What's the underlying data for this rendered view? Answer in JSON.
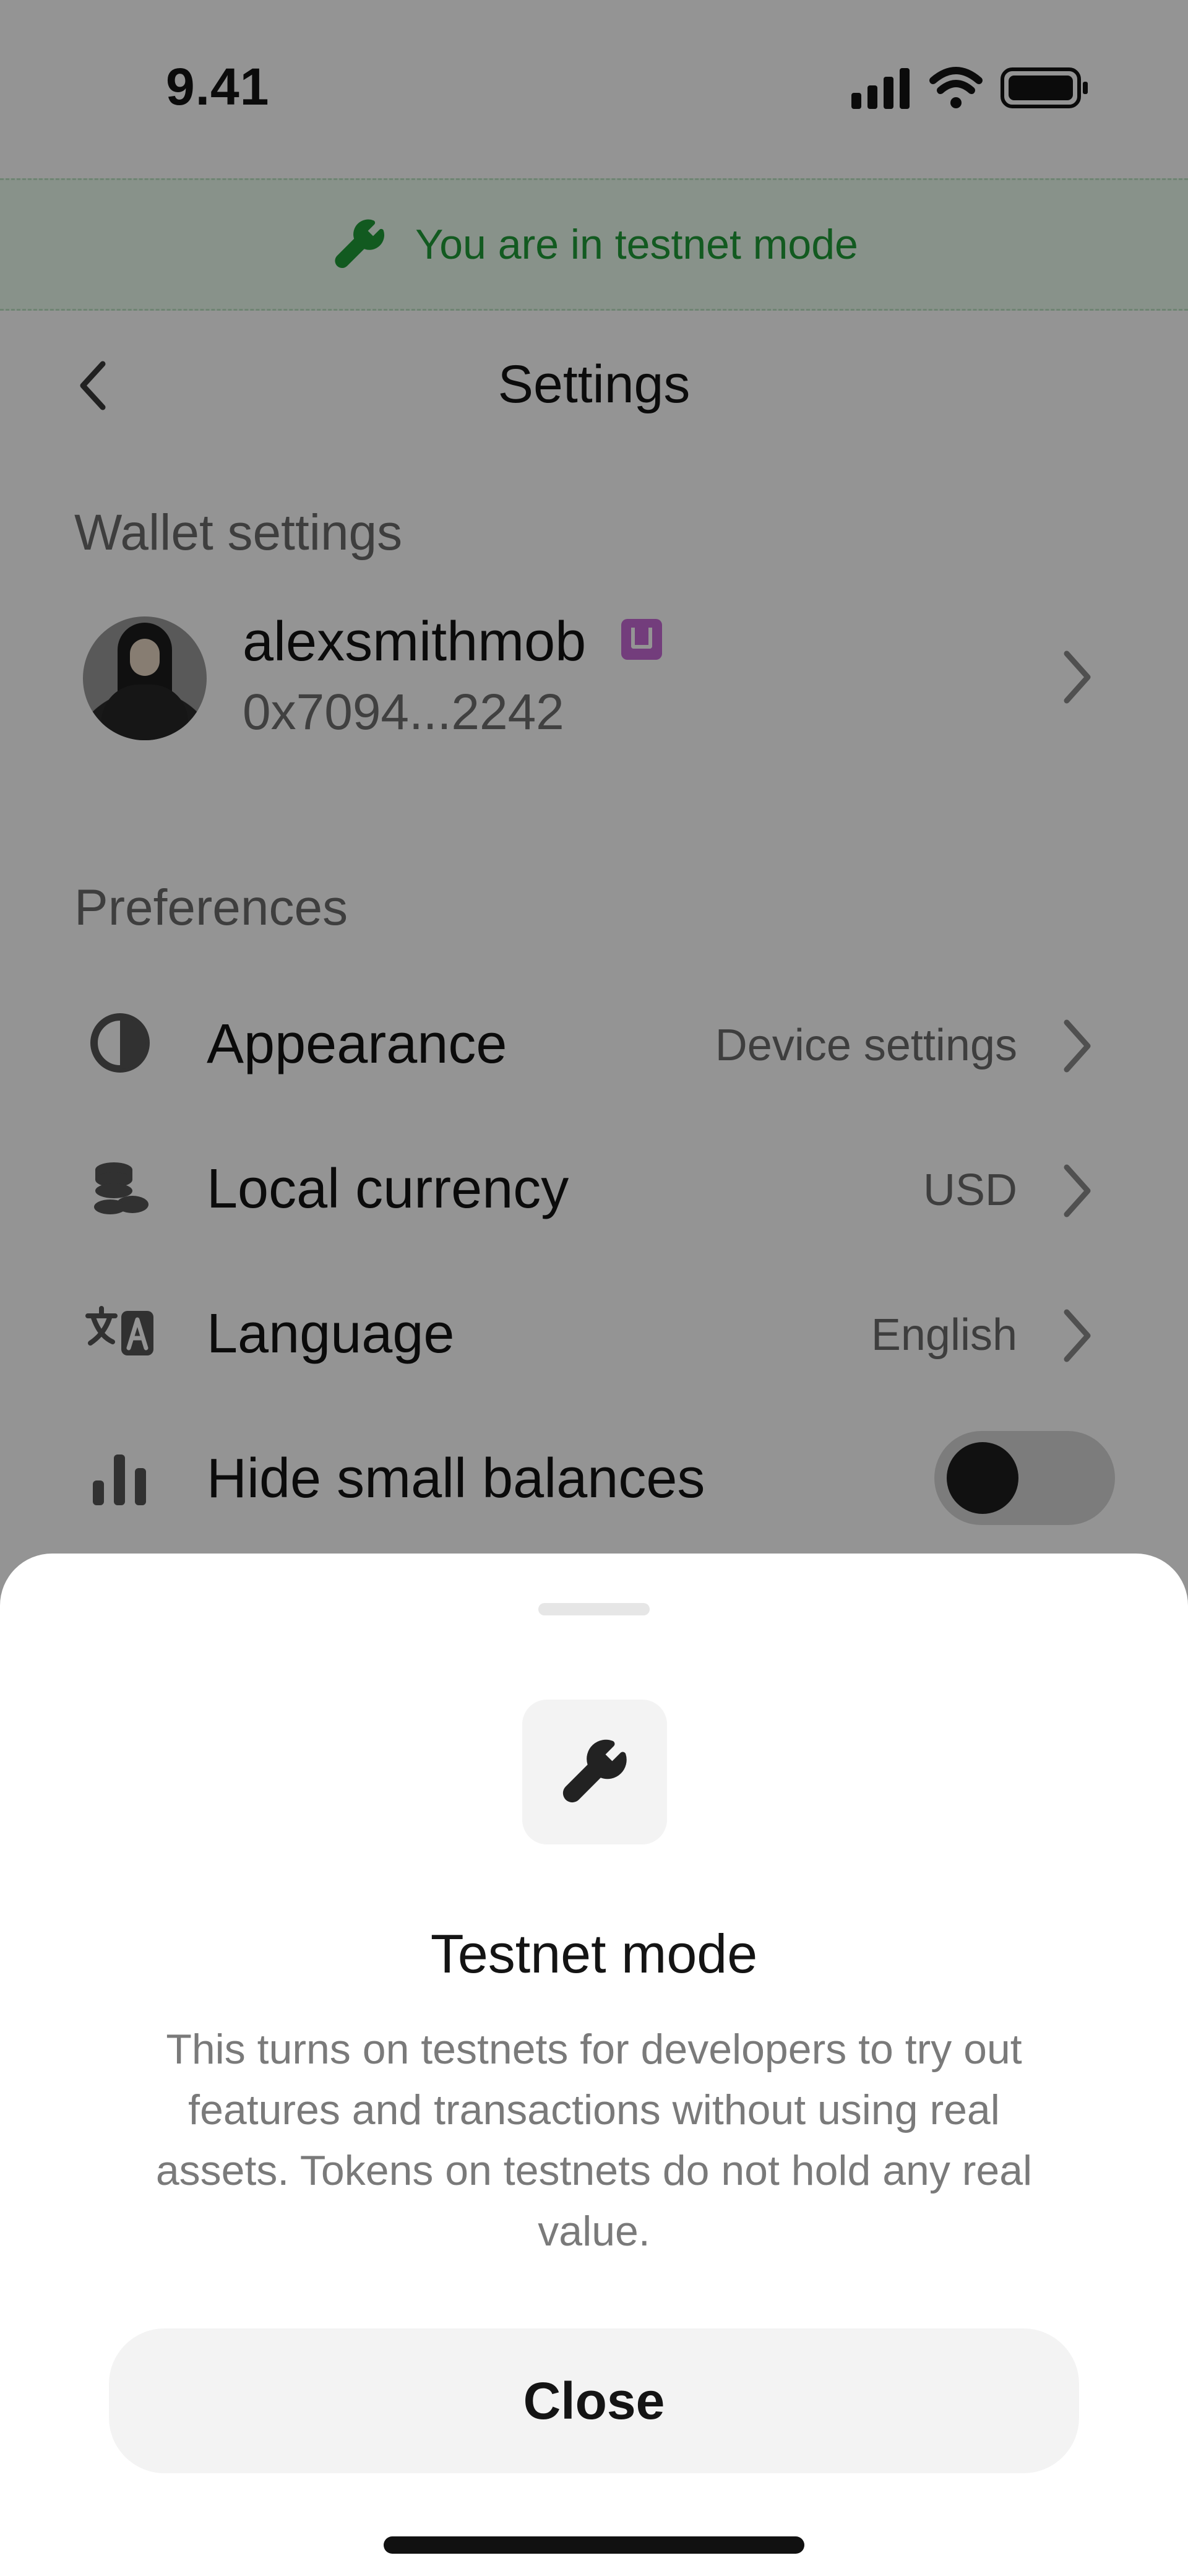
{
  "status_bar": {
    "time": "9.41",
    "icons": [
      "signal-icon",
      "wifi-icon",
      "battery-icon"
    ]
  },
  "banner": {
    "icon": "wrench-icon",
    "text": "You are in testnet mode",
    "color": "#1f9b38",
    "background": "#eafbee"
  },
  "header": {
    "back_icon": "chevron-left-icon",
    "title": "Settings"
  },
  "wallet_section": {
    "title": "Wallet settings",
    "wallet": {
      "name": "alexsmithmob",
      "address": "0x7094...2242",
      "badge_icon": "unitag-badge-icon",
      "badge_color": "#c66ad6"
    }
  },
  "preferences": {
    "title": "Preferences",
    "items": [
      {
        "icon": "contrast-icon",
        "label": "Appearance",
        "value": "Device settings"
      },
      {
        "icon": "coins-icon",
        "label": "Local currency",
        "value": "USD"
      },
      {
        "icon": "translate-icon",
        "label": "Language",
        "value": "English"
      },
      {
        "icon": "bar-chart-icon",
        "label": "Hide small balances",
        "toggle_on": false
      }
    ]
  },
  "sheet": {
    "icon": "wrench-icon",
    "title": "Testnet mode",
    "description": "This turns on testnets for developers to try out features and transactions without using real assets. Tokens on testnets do not hold any real value.",
    "close_label": "Close"
  }
}
